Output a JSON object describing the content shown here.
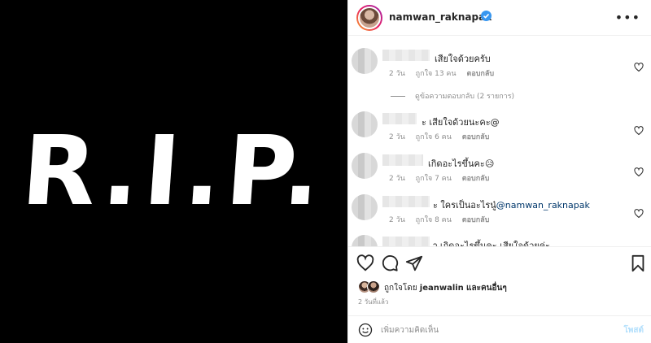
{
  "media": {
    "overlay_text": "R.I.P."
  },
  "header": {
    "username": "namwan_raknapak",
    "more_label": "•••",
    "verified_icon": "verified-badge-icon",
    "accent": "#3897f0"
  },
  "comments": [
    {
      "text": "เสียใจด้วยครับ",
      "time": "2 วัน",
      "likes": "ถูกใจ 13 คน",
      "reply": "ตอบกลับ"
    },
    {
      "text": "ะ เสียใจด้วยนะคะ@",
      "time": "2 วัน",
      "likes": "ถูกใจ 6 คน",
      "reply": "ตอบกลับ"
    },
    {
      "text": "เกิดอะไรขึ้นคะ😥",
      "time": "2 วัน",
      "likes": "ถูกใจ 7 คน",
      "reply": "ตอบกลับ"
    },
    {
      "text": "ะ ใครเป็นอะไรนู๋",
      "mention": "@namwan_raknapak",
      "time": "2 วัน",
      "likes": "ถูกใจ 8 คน",
      "reply": "ตอบกลับ"
    },
    {
      "text": "ๅ เกิดอะไรขึ้นคะ เสียใจด้วยค่ะ"
    }
  ],
  "view_replies": "ดูข้อความตอบกลับ (2 รายการ)",
  "likes": {
    "prefix": "ถูกใจโดย",
    "user": "jeanwalin",
    "and": "และ",
    "others": "คนอื่นๆ"
  },
  "posted_time": "2 วันที่แล้ว",
  "add_comment": {
    "placeholder": "เพิ่มความคิดเห็น",
    "post_label": "โพสต์"
  }
}
